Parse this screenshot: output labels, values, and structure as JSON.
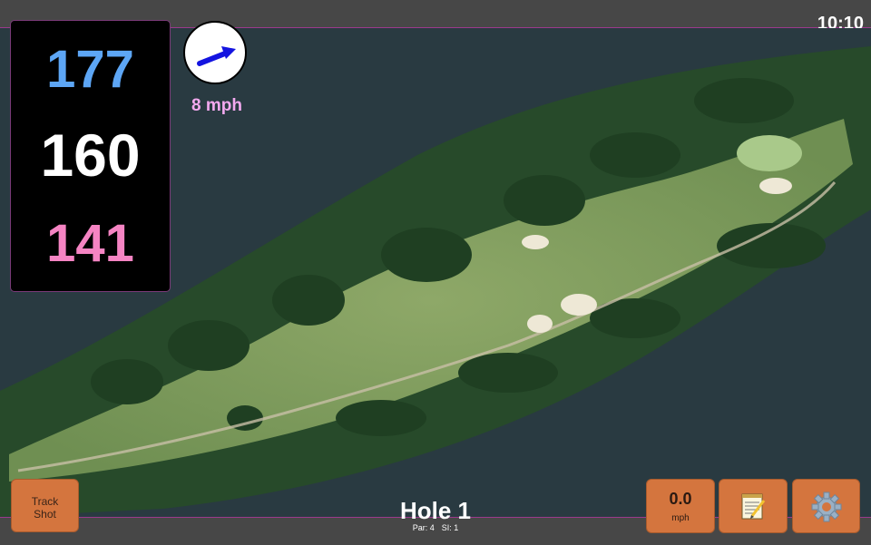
{
  "status": {
    "time": "10:10"
  },
  "yardages": {
    "back": "177",
    "middle": "160",
    "front": "141"
  },
  "wind": {
    "speed": "8 mph",
    "direction_icon": "arrow-icon"
  },
  "hole": {
    "title": "Hole 1",
    "par": "Par: 4",
    "si": "SI: 1"
  },
  "buttons": {
    "track_line1": "Track",
    "track_line2": "Shot",
    "speed_value": "0.0",
    "speed_unit": "mph",
    "notes_icon": "notepad-icon",
    "settings_icon": "gear-icon"
  },
  "colors": {
    "back_yardage": "#5da6f5",
    "middle_yardage": "#ffffff",
    "front_yardage": "#f584c3",
    "wind_text": "#f3a9ef",
    "button_orange": "#d4753e",
    "accent_border": "#9b3a8c"
  }
}
